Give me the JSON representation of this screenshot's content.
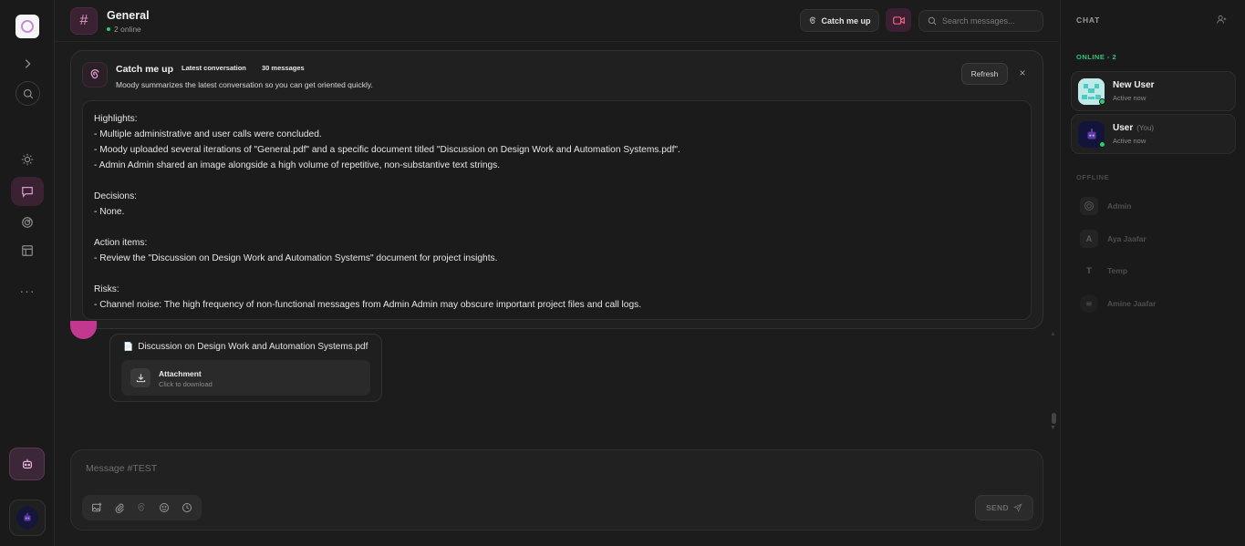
{
  "channel": {
    "name": "General",
    "online_text": "2 online"
  },
  "header": {
    "catch_me_up_label": "Catch me up",
    "search_placeholder": "Search messages..."
  },
  "summary": {
    "title": "Catch me up",
    "badge_latest": "Latest conversation",
    "badge_count": "30 messages",
    "description": "Moody summarizes the latest conversation so you can get oriented quickly.",
    "refresh_label": "Refresh",
    "close_label": "×",
    "lines": [
      "Highlights:",
      "- Multiple administrative and user calls were concluded.",
      "- Moody uploaded several iterations of \"General.pdf\" and a specific document titled \"Discussion on Design Work and Automation Systems.pdf\".",
      "- Admin Admin shared an image alongside a high volume of repetitive, non-substantive text strings.",
      "",
      "Decisions:",
      "- None.",
      "",
      "Action items:",
      "- Review the \"Discussion on Design Work and Automation Systems\" document for project insights.",
      "",
      "Risks:",
      "- Channel noise: The high frequency of non-functional messages from Admin Admin may obscure important project files and call logs."
    ]
  },
  "file_message": {
    "file_name": "Discussion on Design Work and Automation Systems.pdf",
    "attachment_title": "Attachment",
    "attachment_sub": "Click to download"
  },
  "composer": {
    "placeholder": "Message #TEST",
    "send_label": "SEND"
  },
  "right_panel": {
    "title": "CHAT",
    "online_heading": "ONLINE - 2",
    "online_users": [
      {
        "name": "New User",
        "you": "",
        "status": "Active now"
      },
      {
        "name": "User",
        "you": "(You)",
        "status": "Active now"
      }
    ],
    "offline_heading": "OFFLINE",
    "offline_users": [
      {
        "name": "Admin",
        "initial": ""
      },
      {
        "name": "Aya Jaafar",
        "initial": "A"
      },
      {
        "name": "Temp",
        "initial": "T"
      },
      {
        "name": "Amine Jaafar",
        "initial": ""
      }
    ]
  },
  "colors": {
    "accent": "#e097c8",
    "online": "#2ecc71",
    "video": "#ff6b8a"
  }
}
